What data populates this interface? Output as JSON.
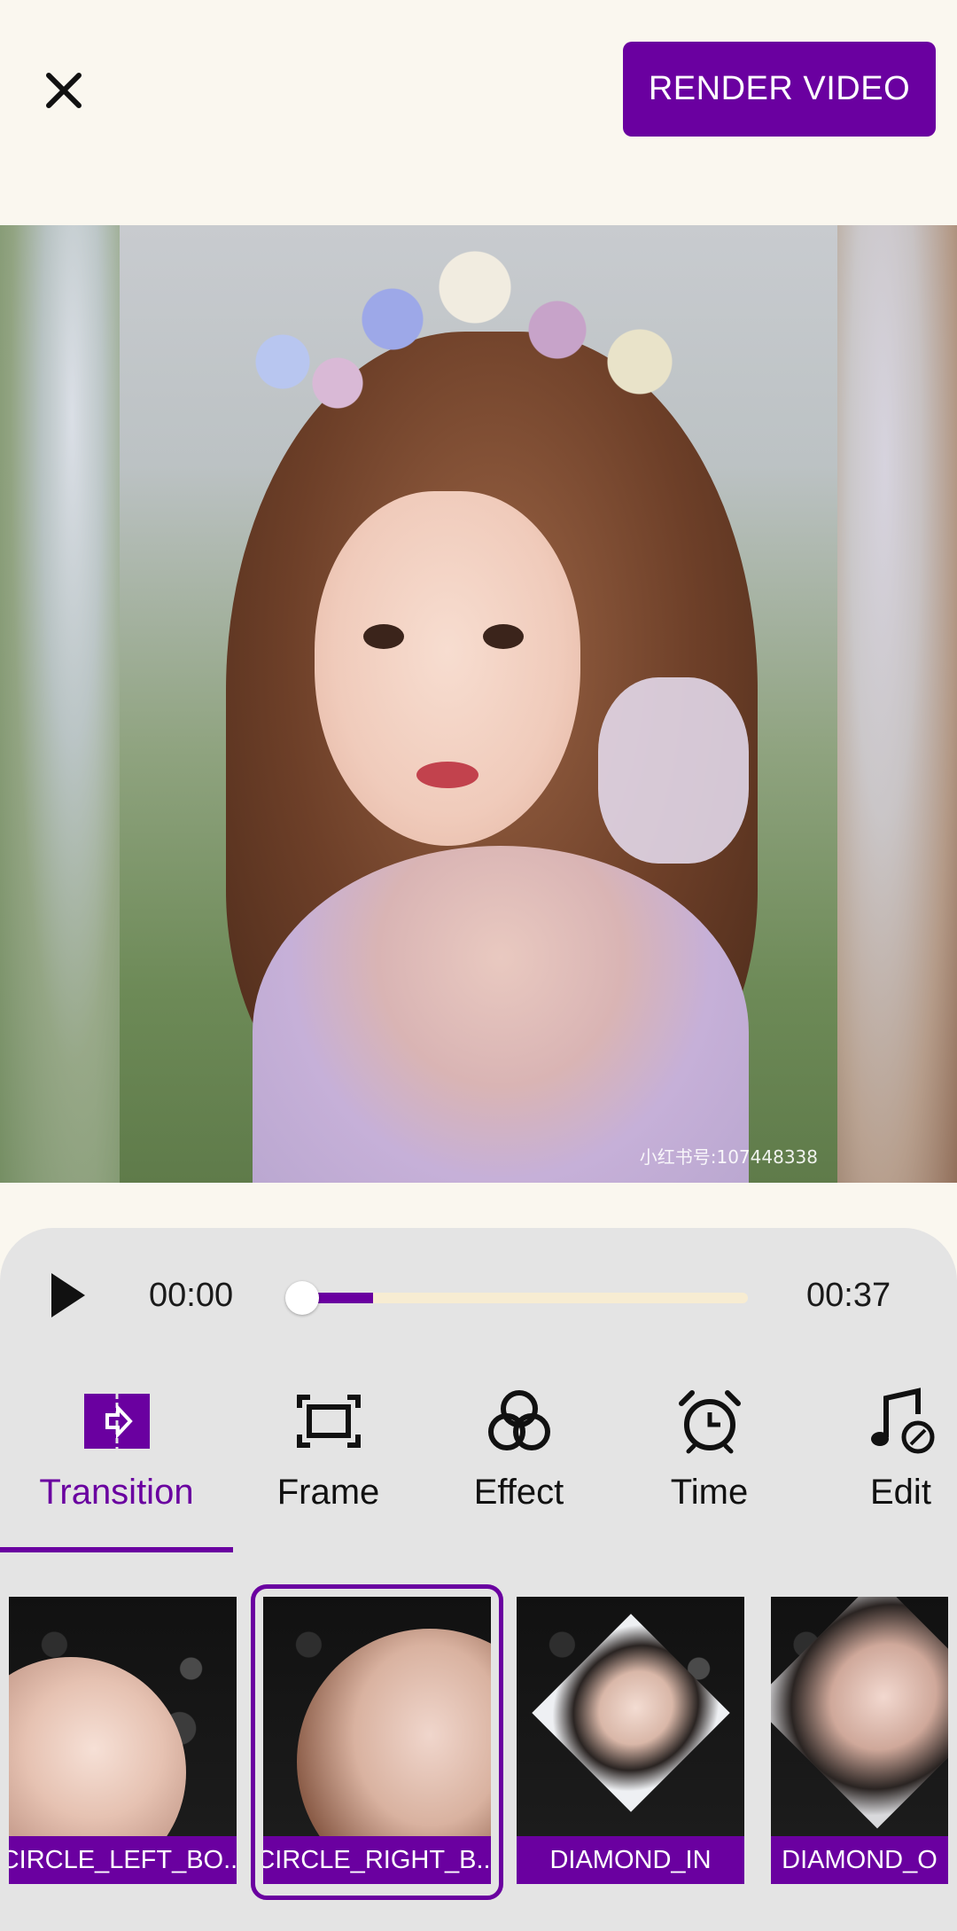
{
  "header": {
    "close_icon": "close-icon",
    "render_label": "RENDER VIDEO"
  },
  "preview": {
    "watermark": "小红书号:107448338"
  },
  "player": {
    "play_icon": "play-icon",
    "current_time": "00:00",
    "total_time": "00:37",
    "progress": 0.17
  },
  "tabs": [
    {
      "label": "Transition",
      "icon": "transition-icon",
      "active": true
    },
    {
      "label": "Frame",
      "icon": "frame-icon",
      "active": false
    },
    {
      "label": "Effect",
      "icon": "effect-icon",
      "active": false
    },
    {
      "label": "Time",
      "icon": "alarm-clock-icon",
      "active": false
    },
    {
      "label": "Edit",
      "icon": "music-edit-icon",
      "active": false
    }
  ],
  "transitions": [
    {
      "label": "CIRCLE_LEFT_BO...",
      "selected": false
    },
    {
      "label": "CIRCLE_RIGHT_B...",
      "selected": true
    },
    {
      "label": "DIAMOND_IN",
      "selected": false
    },
    {
      "label": "DIAMOND_O",
      "selected": false
    }
  ],
  "colors": {
    "accent": "#6a00a0",
    "background": "#faf7ef",
    "panel": "#e4e4e4"
  }
}
